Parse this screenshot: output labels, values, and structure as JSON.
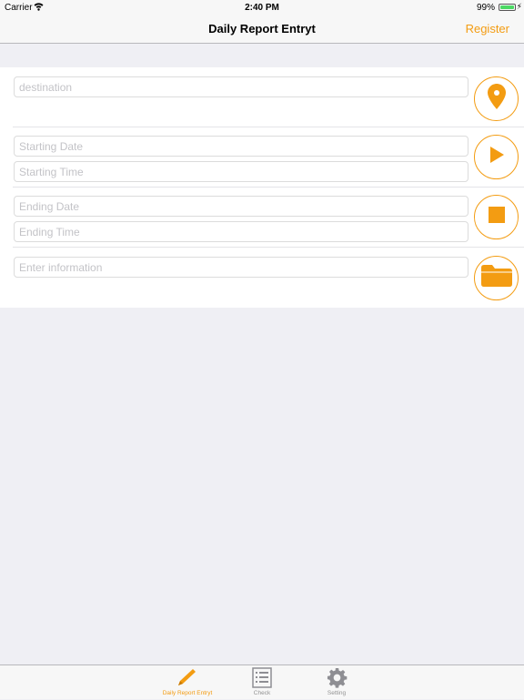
{
  "status_bar": {
    "carrier": "Carrier",
    "time": "2:40 PM",
    "battery": "99%",
    "battery_level": 0.99
  },
  "nav": {
    "title": "Daily Report Entryt",
    "register_label": "Register"
  },
  "form": {
    "destination_placeholder": "destination",
    "starting_date_placeholder": "Starting Date",
    "starting_time_placeholder": "Starting Time",
    "ending_date_placeholder": "Ending Date",
    "ending_time_placeholder": "Ending Time",
    "information_placeholder": "Enter information",
    "location_icon": "location-pin-icon",
    "start_icon": "play-icon",
    "stop_icon": "stop-icon",
    "folder_icon": "folder-icon"
  },
  "tabs": [
    {
      "label": "Daily Report Entryt",
      "icon": "pencil-icon",
      "active": true
    },
    {
      "label": "Check",
      "icon": "checklist-icon",
      "active": false
    },
    {
      "label": "Setting",
      "icon": "gear-icon",
      "active": false
    }
  ],
  "colors": {
    "accent": "#f39c12",
    "background": "#efeff4",
    "inactive": "#929292",
    "battery": "#4cd964"
  }
}
